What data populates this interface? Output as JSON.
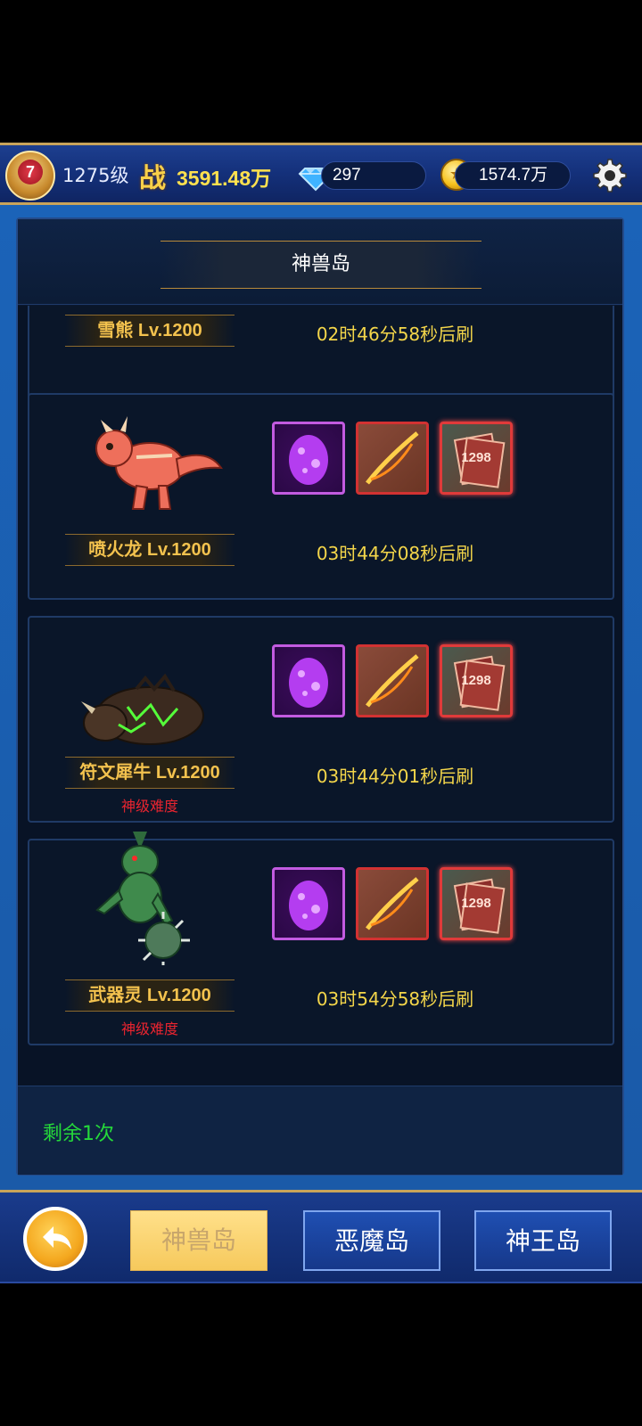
{
  "topbar": {
    "vip_level": "7",
    "player_level": "1275级",
    "power_icon": "战",
    "power_value": "3591.48万",
    "diamonds": "297",
    "gold": "1574.7万",
    "icons": [
      "vip-badge-icon",
      "diamond-icon",
      "gold-coin-icon",
      "gear-icon"
    ]
  },
  "panel": {
    "title": "神兽岛"
  },
  "bosses": [
    {
      "name": "雪熊 Lv.1200",
      "timer": "02时46分58秒后刷",
      "difficulty": ""
    },
    {
      "name": "喷火龙 Lv.1200",
      "timer": "03时44分08秒后刷",
      "difficulty": ""
    },
    {
      "name": "符文犀牛 Lv.1200",
      "timer": "03时44分01秒后刷",
      "difficulty": "神级难度"
    },
    {
      "name": "武器灵 Lv.1200",
      "timer": "03时54分58秒后刷",
      "difficulty": "神级难度"
    }
  ],
  "rewards": {
    "card_count": "1298",
    "items": [
      "purple-egg-icon",
      "bow-icon",
      "card-pack-icon"
    ]
  },
  "remaining": "剩余1次",
  "nav": {
    "tab1": "神兽岛",
    "tab2": "恶魔岛",
    "tab3": "神王岛"
  },
  "colors": {
    "accent_gold": "#f3c24e",
    "timer_yellow": "#f4d64a",
    "difficulty_red": "#e8242f",
    "remaining_green": "#25d93a"
  }
}
